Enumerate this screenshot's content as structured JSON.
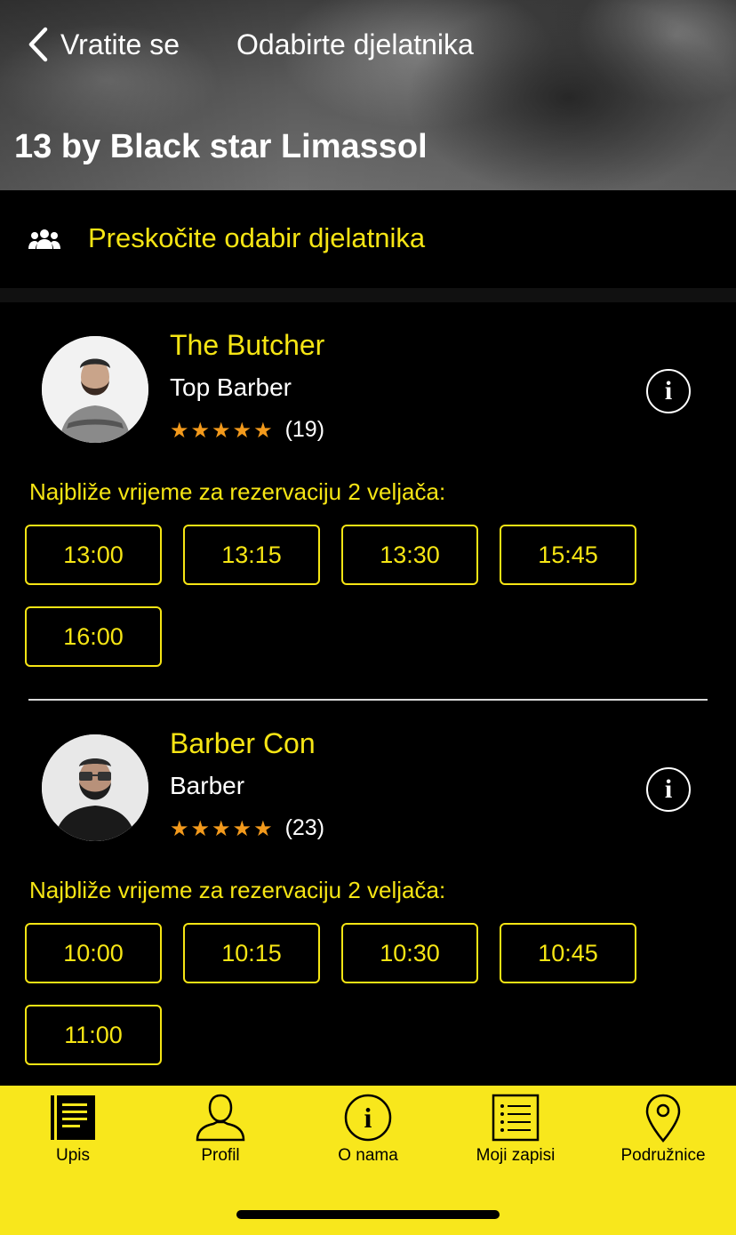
{
  "header": {
    "back_label": "Vratite se",
    "title": "Odabirte djelatnika",
    "shop_name": "13 by Black star Limassol"
  },
  "skip": {
    "label": "Preskočite odabir djelatnika",
    "icon": "people-icon"
  },
  "barbers": [
    {
      "name": "The Butcher",
      "role": "Top Barber",
      "stars": "★★★★★",
      "rating_value": 5,
      "review_count": "(19)",
      "availability_label": "Najbliže vrijeme za rezervaciju 2 veljača:",
      "slots": [
        "13:00",
        "13:15",
        "13:30",
        "15:45",
        "16:00"
      ]
    },
    {
      "name": "Barber Con",
      "role": "Barber",
      "stars": "★★★★★",
      "rating_value": 5,
      "review_count": "(23)",
      "availability_label": "Najbliže vrijeme za rezervaciju 2 veljača:",
      "slots": [
        "10:00",
        "10:15",
        "10:30",
        "10:45",
        "11:00"
      ]
    }
  ],
  "tabbar": {
    "items": [
      {
        "label": "Upis",
        "icon": "book-icon"
      },
      {
        "label": "Profil",
        "icon": "user-icon"
      },
      {
        "label": "O nama",
        "icon": "info-icon"
      },
      {
        "label": "Moji zapisi",
        "icon": "list-icon"
      },
      {
        "label": "Podružnice",
        "icon": "location-pin-icon"
      }
    ]
  },
  "colors": {
    "accent": "#f6e514",
    "tabbar_bg": "#f8e71c",
    "star": "#f39a1c",
    "background": "#000000"
  }
}
